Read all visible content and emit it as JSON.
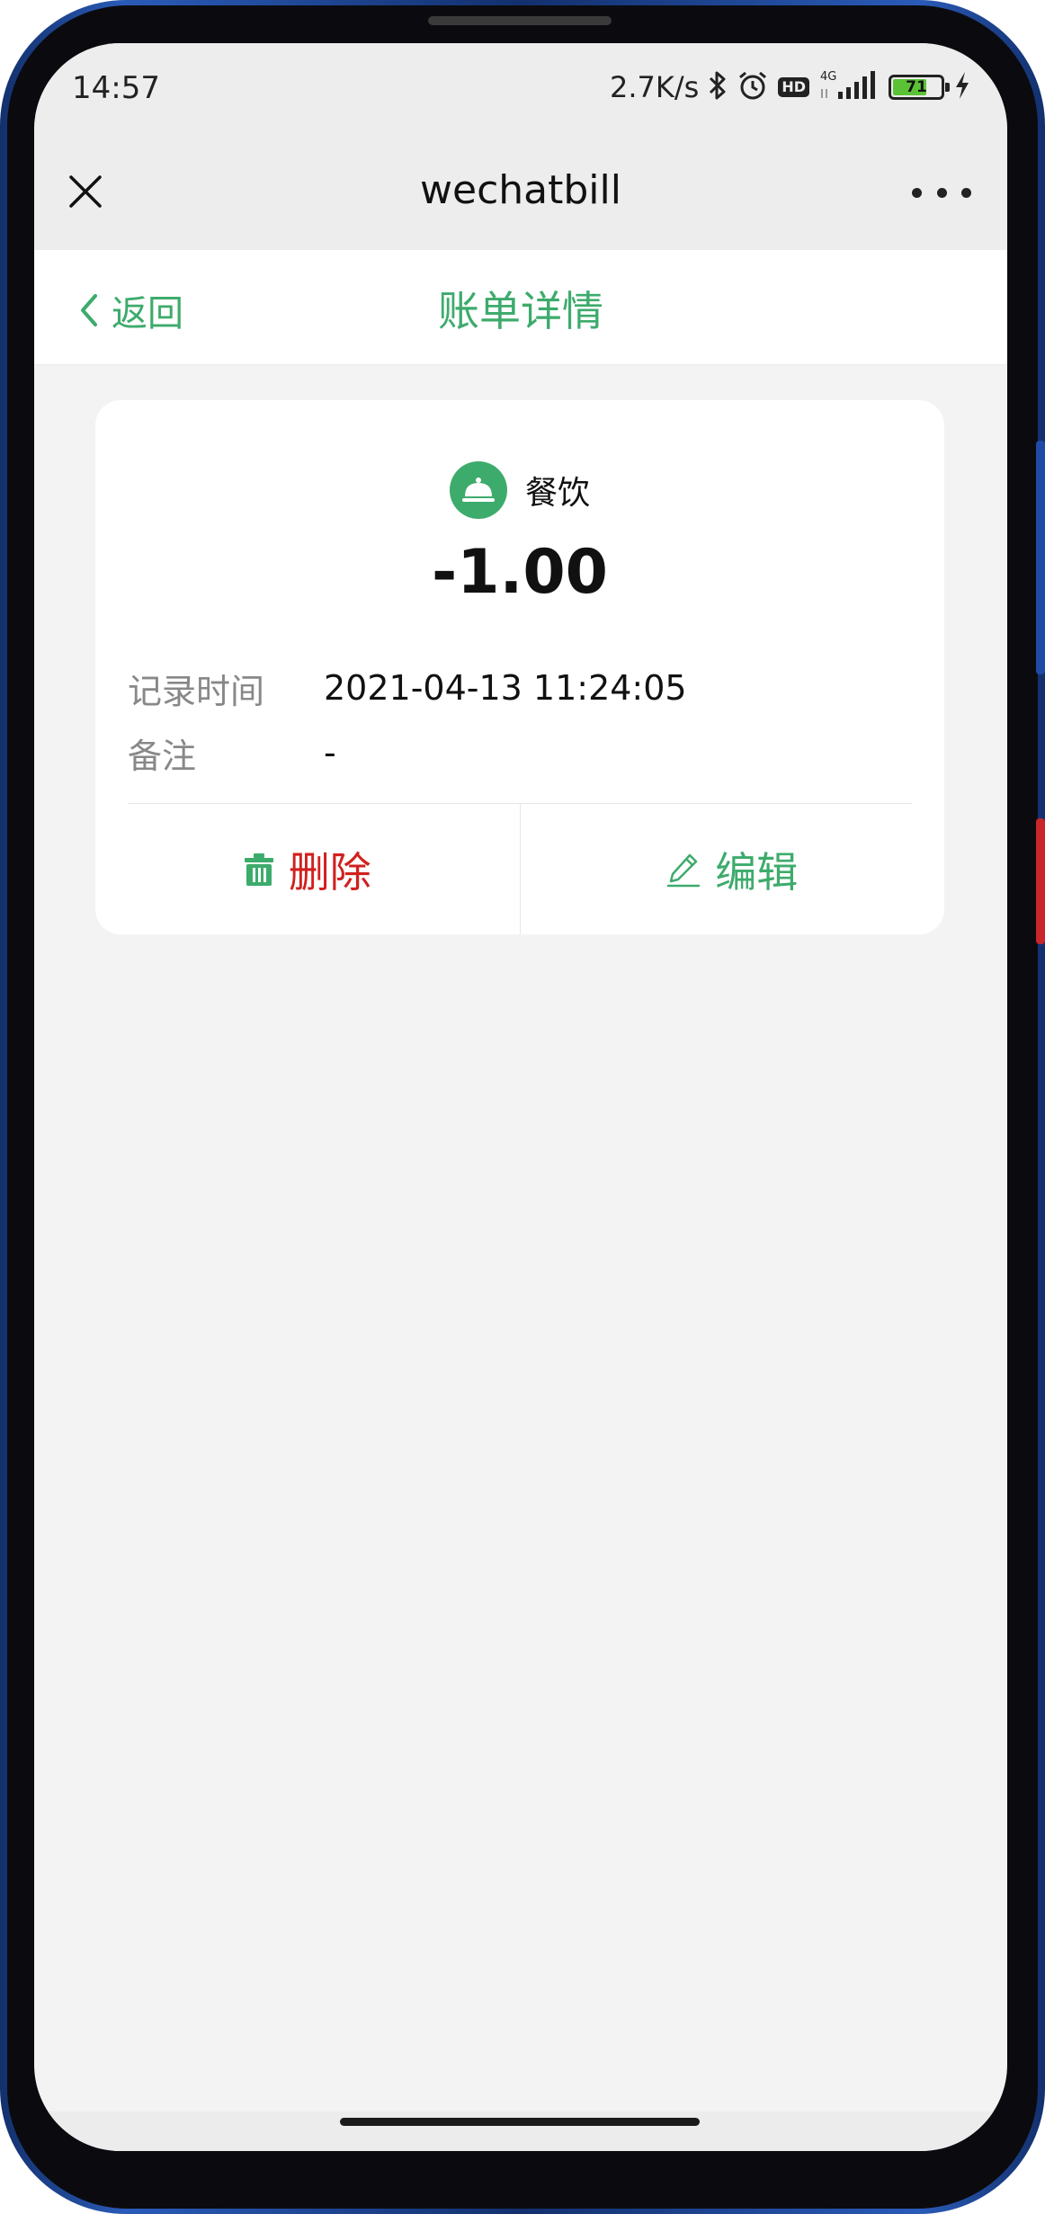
{
  "status_bar": {
    "time": "14:57",
    "net_speed": "2.7K/s",
    "network_type": "4G",
    "hd_badge": "HD",
    "battery_level": "71",
    "battery_fraction": 0.71,
    "icons": [
      "bluetooth-icon",
      "alarm-icon",
      "hd-icon",
      "signal-icon",
      "battery-icon",
      "charging-icon"
    ]
  },
  "title_bar": {
    "app_name": "wechatbill",
    "icons": [
      "close-icon",
      "more-icon"
    ]
  },
  "nav": {
    "back_label": "返回",
    "page_title": "账单详情"
  },
  "bill": {
    "category": "餐饮",
    "category_icon": "dining-bell-icon",
    "amount": "-1.00",
    "fields": [
      {
        "label": "记录时间",
        "value": "2021-04-13 11:24:05"
      },
      {
        "label": "备注",
        "value": "-"
      }
    ]
  },
  "actions": {
    "delete_label": "删除",
    "edit_label": "编辑"
  },
  "colors": {
    "accent_green": "#3dab6c",
    "delete_red": "#d0211e",
    "page_bg": "#f3f3f3",
    "bar_bg": "#ededed"
  }
}
